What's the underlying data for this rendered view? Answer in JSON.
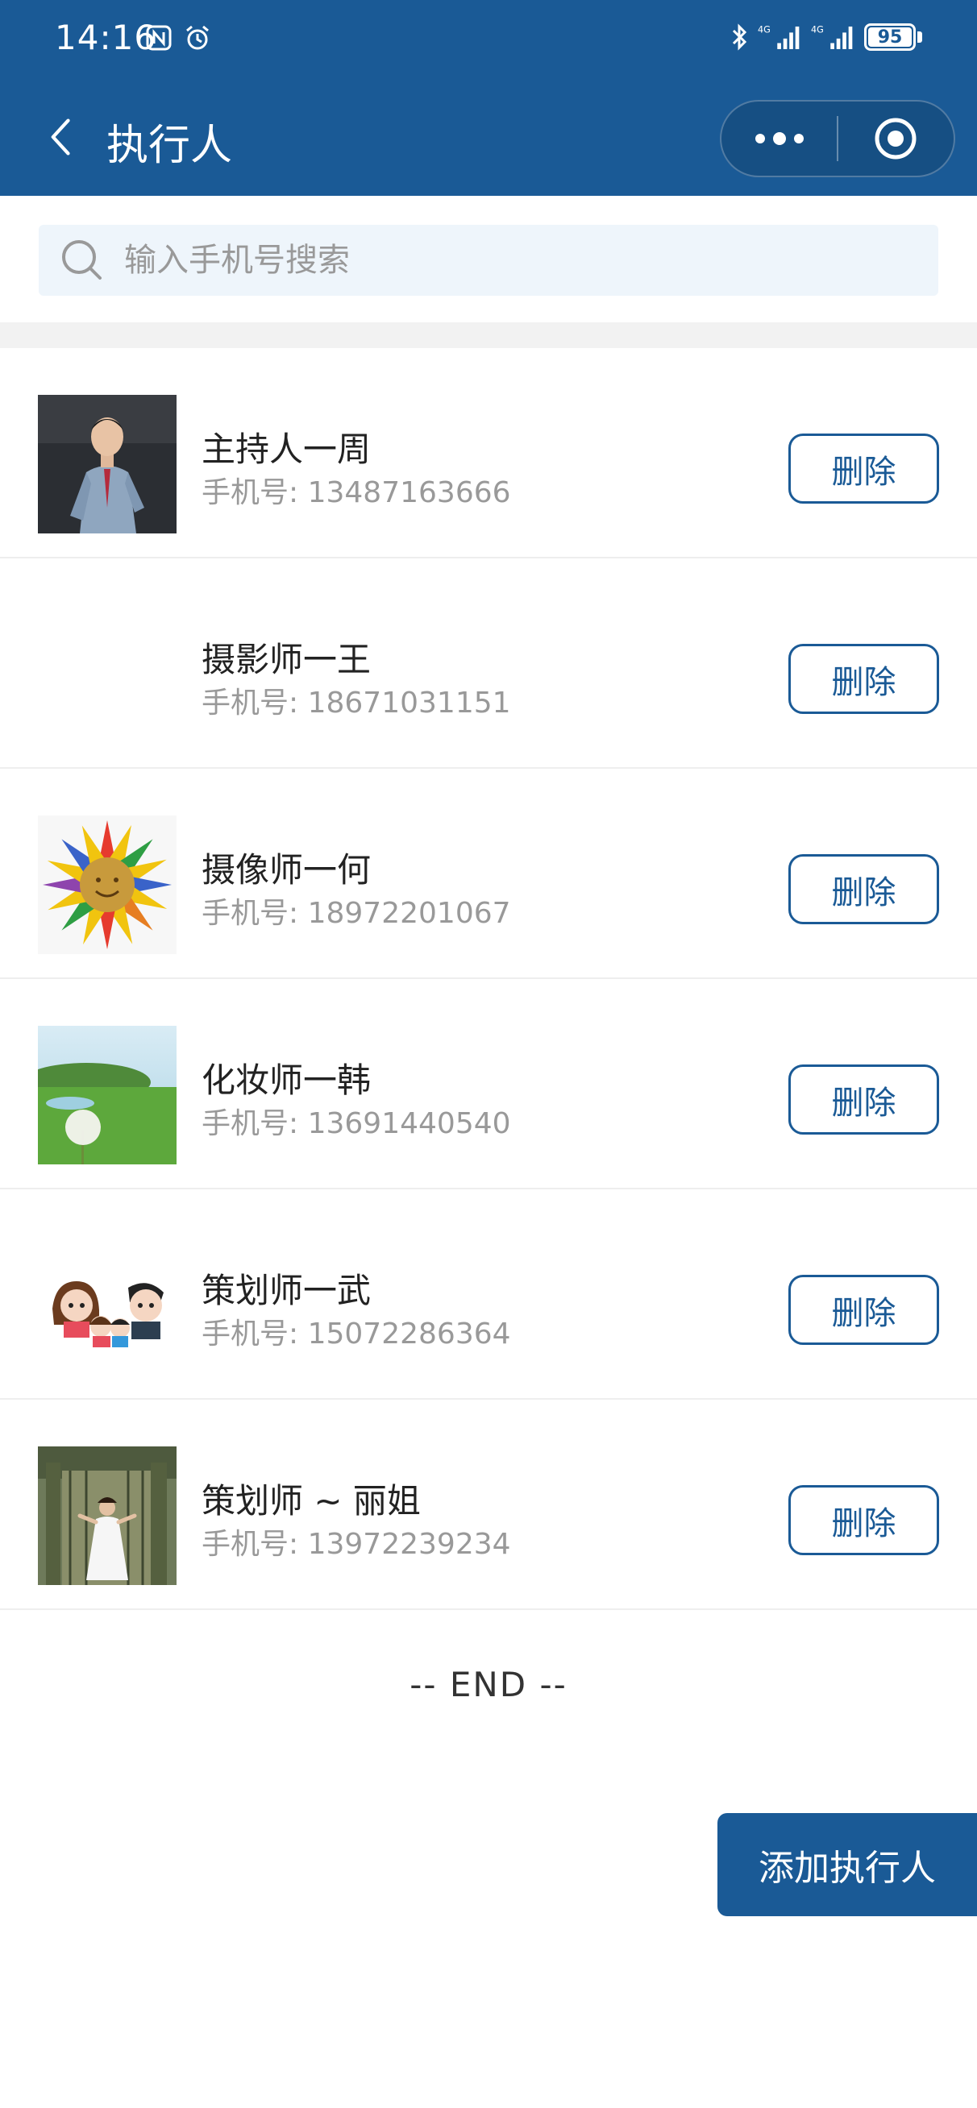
{
  "status_bar": {
    "time": "14:16",
    "battery": "95"
  },
  "nav": {
    "title": "执行人"
  },
  "search": {
    "placeholder": "输入手机号搜索",
    "value": ""
  },
  "list": {
    "phone_prefix": "手机号:",
    "delete_label": "删除",
    "items": [
      {
        "name": "主持人一周",
        "phone": "13487163666",
        "avatar": "photo-man-suit"
      },
      {
        "name": "摄影师一王",
        "phone": "18671031151",
        "avatar": "blank"
      },
      {
        "name": "摄像师一何",
        "phone": "18972201067",
        "avatar": "sunflower-smiley"
      },
      {
        "name": "化妆师一韩",
        "phone": "13691440540",
        "avatar": "dandelion-meadow"
      },
      {
        "name": "策划师一武",
        "phone": "15072286364",
        "avatar": "cartoon-family"
      },
      {
        "name": "策划师 ~ 丽姐",
        "phone": "13972239234",
        "avatar": "photo-woman-white-dress"
      }
    ]
  },
  "footer": {
    "end_text": "-- END --",
    "add_button": "添加执行人"
  },
  "colors": {
    "brand": "#1a5a96",
    "search_bg": "#eef5fb",
    "divider": "#f2f2f2"
  }
}
